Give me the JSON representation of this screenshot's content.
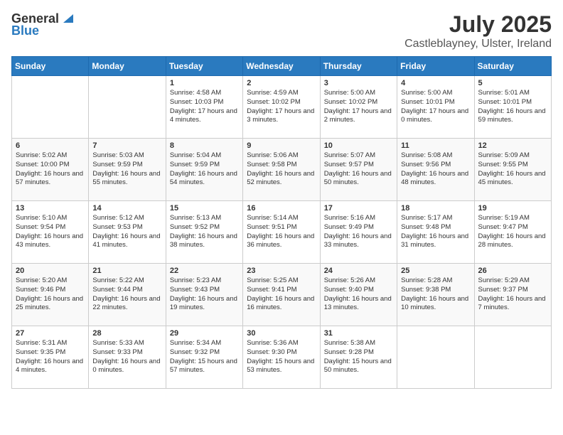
{
  "header": {
    "logo_general": "General",
    "logo_blue": "Blue",
    "month_title": "July 2025",
    "location": "Castleblayney, Ulster, Ireland"
  },
  "weekdays": [
    "Sunday",
    "Monday",
    "Tuesday",
    "Wednesday",
    "Thursday",
    "Friday",
    "Saturday"
  ],
  "weeks": [
    [
      {
        "day": "",
        "info": ""
      },
      {
        "day": "",
        "info": ""
      },
      {
        "day": "1",
        "info": "Sunrise: 4:58 AM\nSunset: 10:03 PM\nDaylight: 17 hours\nand 4 minutes."
      },
      {
        "day": "2",
        "info": "Sunrise: 4:59 AM\nSunset: 10:02 PM\nDaylight: 17 hours\nand 3 minutes."
      },
      {
        "day": "3",
        "info": "Sunrise: 5:00 AM\nSunset: 10:02 PM\nDaylight: 17 hours\nand 2 minutes."
      },
      {
        "day": "4",
        "info": "Sunrise: 5:00 AM\nSunset: 10:01 PM\nDaylight: 17 hours\nand 0 minutes."
      },
      {
        "day": "5",
        "info": "Sunrise: 5:01 AM\nSunset: 10:01 PM\nDaylight: 16 hours\nand 59 minutes."
      }
    ],
    [
      {
        "day": "6",
        "info": "Sunrise: 5:02 AM\nSunset: 10:00 PM\nDaylight: 16 hours\nand 57 minutes."
      },
      {
        "day": "7",
        "info": "Sunrise: 5:03 AM\nSunset: 9:59 PM\nDaylight: 16 hours\nand 55 minutes."
      },
      {
        "day": "8",
        "info": "Sunrise: 5:04 AM\nSunset: 9:59 PM\nDaylight: 16 hours\nand 54 minutes."
      },
      {
        "day": "9",
        "info": "Sunrise: 5:06 AM\nSunset: 9:58 PM\nDaylight: 16 hours\nand 52 minutes."
      },
      {
        "day": "10",
        "info": "Sunrise: 5:07 AM\nSunset: 9:57 PM\nDaylight: 16 hours\nand 50 minutes."
      },
      {
        "day": "11",
        "info": "Sunrise: 5:08 AM\nSunset: 9:56 PM\nDaylight: 16 hours\nand 48 minutes."
      },
      {
        "day": "12",
        "info": "Sunrise: 5:09 AM\nSunset: 9:55 PM\nDaylight: 16 hours\nand 45 minutes."
      }
    ],
    [
      {
        "day": "13",
        "info": "Sunrise: 5:10 AM\nSunset: 9:54 PM\nDaylight: 16 hours\nand 43 minutes."
      },
      {
        "day": "14",
        "info": "Sunrise: 5:12 AM\nSunset: 9:53 PM\nDaylight: 16 hours\nand 41 minutes."
      },
      {
        "day": "15",
        "info": "Sunrise: 5:13 AM\nSunset: 9:52 PM\nDaylight: 16 hours\nand 38 minutes."
      },
      {
        "day": "16",
        "info": "Sunrise: 5:14 AM\nSunset: 9:51 PM\nDaylight: 16 hours\nand 36 minutes."
      },
      {
        "day": "17",
        "info": "Sunrise: 5:16 AM\nSunset: 9:49 PM\nDaylight: 16 hours\nand 33 minutes."
      },
      {
        "day": "18",
        "info": "Sunrise: 5:17 AM\nSunset: 9:48 PM\nDaylight: 16 hours\nand 31 minutes."
      },
      {
        "day": "19",
        "info": "Sunrise: 5:19 AM\nSunset: 9:47 PM\nDaylight: 16 hours\nand 28 minutes."
      }
    ],
    [
      {
        "day": "20",
        "info": "Sunrise: 5:20 AM\nSunset: 9:46 PM\nDaylight: 16 hours\nand 25 minutes."
      },
      {
        "day": "21",
        "info": "Sunrise: 5:22 AM\nSunset: 9:44 PM\nDaylight: 16 hours\nand 22 minutes."
      },
      {
        "day": "22",
        "info": "Sunrise: 5:23 AM\nSunset: 9:43 PM\nDaylight: 16 hours\nand 19 minutes."
      },
      {
        "day": "23",
        "info": "Sunrise: 5:25 AM\nSunset: 9:41 PM\nDaylight: 16 hours\nand 16 minutes."
      },
      {
        "day": "24",
        "info": "Sunrise: 5:26 AM\nSunset: 9:40 PM\nDaylight: 16 hours\nand 13 minutes."
      },
      {
        "day": "25",
        "info": "Sunrise: 5:28 AM\nSunset: 9:38 PM\nDaylight: 16 hours\nand 10 minutes."
      },
      {
        "day": "26",
        "info": "Sunrise: 5:29 AM\nSunset: 9:37 PM\nDaylight: 16 hours\nand 7 minutes."
      }
    ],
    [
      {
        "day": "27",
        "info": "Sunrise: 5:31 AM\nSunset: 9:35 PM\nDaylight: 16 hours\nand 4 minutes."
      },
      {
        "day": "28",
        "info": "Sunrise: 5:33 AM\nSunset: 9:33 PM\nDaylight: 16 hours\nand 0 minutes."
      },
      {
        "day": "29",
        "info": "Sunrise: 5:34 AM\nSunset: 9:32 PM\nDaylight: 15 hours\nand 57 minutes."
      },
      {
        "day": "30",
        "info": "Sunrise: 5:36 AM\nSunset: 9:30 PM\nDaylight: 15 hours\nand 53 minutes."
      },
      {
        "day": "31",
        "info": "Sunrise: 5:38 AM\nSunset: 9:28 PM\nDaylight: 15 hours\nand 50 minutes."
      },
      {
        "day": "",
        "info": ""
      },
      {
        "day": "",
        "info": ""
      }
    ]
  ]
}
